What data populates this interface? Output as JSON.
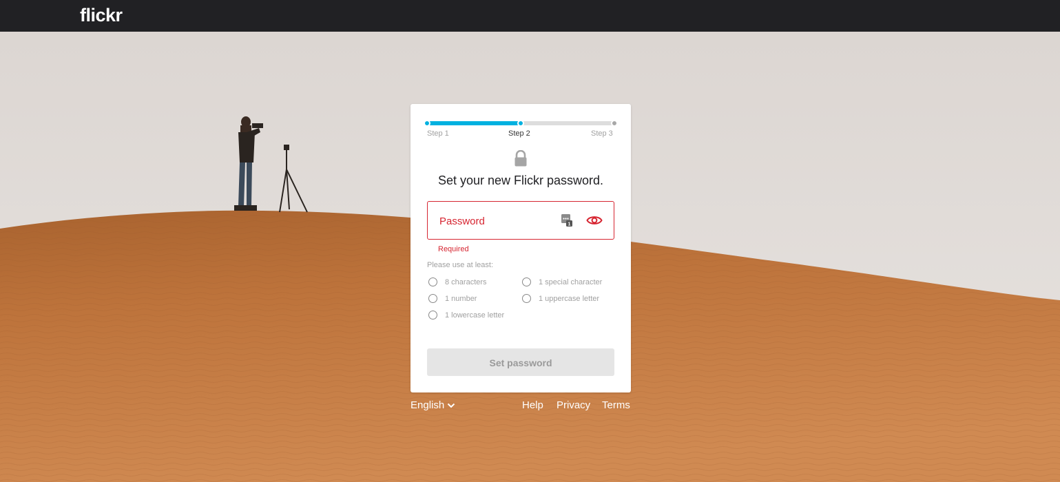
{
  "brand": {
    "logo_text": "flickr"
  },
  "progress": {
    "current_step": 2,
    "fraction": 0.5,
    "steps": [
      "Step 1",
      "Step 2",
      "Step 3"
    ]
  },
  "card": {
    "title": "Set your new Flickr password.",
    "password_placeholder": "Password",
    "error_text": "Required",
    "hint_title": "Please use at least:",
    "requirements": [
      "8 characters",
      "1 special character",
      "1 number",
      "1 uppercase letter",
      "1 lowercase letter"
    ],
    "submit_label": "Set password"
  },
  "footer": {
    "language": "English",
    "links": [
      "Help",
      "Privacy",
      "Terms"
    ]
  },
  "colors": {
    "topbar": "#212124",
    "accent": "#00b1e0",
    "error": "#d62430",
    "sand": "#c77d45",
    "sky": "#e1dcd8"
  },
  "icons": [
    "lock-icon",
    "password-manager-icon",
    "eye-icon",
    "chevron-down-icon"
  ]
}
